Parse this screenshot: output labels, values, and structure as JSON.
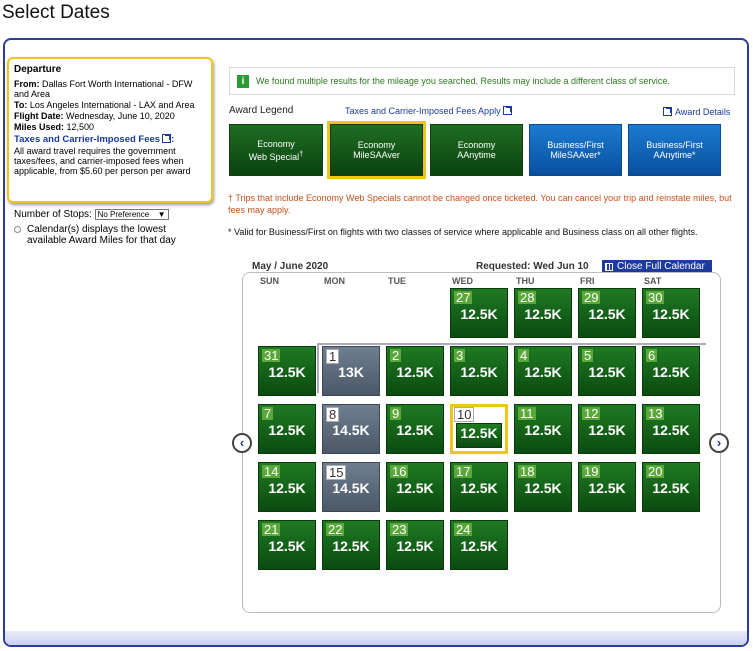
{
  "page_title": "Select Dates",
  "departure": {
    "heading": "Departure",
    "from_label": "From:",
    "from_value": "Dallas Fort Worth International - DFW and Area",
    "to_label": "To:",
    "to_value": "Los Angeles International - LAX and Area",
    "date_label": "Flight Date:",
    "date_value": "Wednesday, June 10, 2020",
    "miles_label": "Miles Used:",
    "miles_value": "12,500",
    "fees_link": "Taxes and Carrier-Imposed Fees",
    "fees_colon": ":",
    "fees_note": "All award travel requires the government taxes/fees, and carrier-imposed fees when applicable, from $5.60 per person per award"
  },
  "stops": {
    "label": "Number of Stops:",
    "selected": "No Preference"
  },
  "calendar_note": "Calendar(s) displays the lowest available Award Miles for that day",
  "info_message": "We found multiple results for the mileage you searched. Results may include a different class of service.",
  "legend": {
    "label": "Award Legend",
    "fees_link": "Taxes and Carrier-Imposed Fees Apply",
    "details_link": "Award Details",
    "buttons": [
      {
        "line1": "Economy",
        "line2": "Web Special",
        "mark": "†"
      },
      {
        "line1": "Economy",
        "line2": "MileSAAver",
        "mark": ""
      },
      {
        "line1": "Economy",
        "line2": "AAnytime",
        "mark": ""
      },
      {
        "line1": "Business/First",
        "line2": "MileSAAver*",
        "mark": ""
      },
      {
        "line1": "Business/First",
        "line2": "AAnytime*",
        "mark": ""
      }
    ]
  },
  "notes": {
    "dagger": "† Trips that include Economy Web Specials cannot be changed once ticketed. You can cancel your trip and reinstate miles, but fees may apply.",
    "star": "* Valid for Business/First on flights with two classes of service where applicable and Business class on all other flights."
  },
  "calendar": {
    "month_label": "May / June 2020",
    "requested": "Requested: Wed Jun 10",
    "close_button": "Close Full Calendar",
    "weekdays": [
      "SUN",
      "MON",
      "TUE",
      "WED",
      "THU",
      "FRI",
      "SAT"
    ],
    "days": [
      {
        "day": "27",
        "value": "12.5K",
        "type": "green"
      },
      {
        "day": "28",
        "value": "12.5K",
        "type": "green"
      },
      {
        "day": "29",
        "value": "12.5K",
        "type": "green"
      },
      {
        "day": "30",
        "value": "12.5K",
        "type": "green"
      },
      {
        "day": "31",
        "value": "12.5K",
        "type": "green"
      },
      {
        "day": "1",
        "value": "13K",
        "type": "gray"
      },
      {
        "day": "2",
        "value": "12.5K",
        "type": "green"
      },
      {
        "day": "3",
        "value": "12.5K",
        "type": "green"
      },
      {
        "day": "4",
        "value": "12.5K",
        "type": "green"
      },
      {
        "day": "5",
        "value": "12.5K",
        "type": "green"
      },
      {
        "day": "6",
        "value": "12.5K",
        "type": "green"
      },
      {
        "day": "7",
        "value": "12.5K",
        "type": "green"
      },
      {
        "day": "8",
        "value": "14.5K",
        "type": "gray"
      },
      {
        "day": "9",
        "value": "12.5K",
        "type": "green"
      },
      {
        "day": "10",
        "value": "12.5K",
        "type": "selected"
      },
      {
        "day": "11",
        "value": "12.5K",
        "type": "green"
      },
      {
        "day": "12",
        "value": "12.5K",
        "type": "green"
      },
      {
        "day": "13",
        "value": "12.5K",
        "type": "green"
      },
      {
        "day": "14",
        "value": "12.5K",
        "type": "green"
      },
      {
        "day": "15",
        "value": "14.5K",
        "type": "gray"
      },
      {
        "day": "16",
        "value": "12.5K",
        "type": "green"
      },
      {
        "day": "17",
        "value": "12.5K",
        "type": "green"
      },
      {
        "day": "18",
        "value": "12.5K",
        "type": "green"
      },
      {
        "day": "19",
        "value": "12.5K",
        "type": "green"
      },
      {
        "day": "20",
        "value": "12.5K",
        "type": "green"
      },
      {
        "day": "21",
        "value": "12.5K",
        "type": "green"
      },
      {
        "day": "22",
        "value": "12.5K",
        "type": "green"
      },
      {
        "day": "23",
        "value": "12.5K",
        "type": "green"
      },
      {
        "day": "24",
        "value": "12.5K",
        "type": "green"
      }
    ],
    "prev_arrow": "‹",
    "next_arrow": "›"
  }
}
